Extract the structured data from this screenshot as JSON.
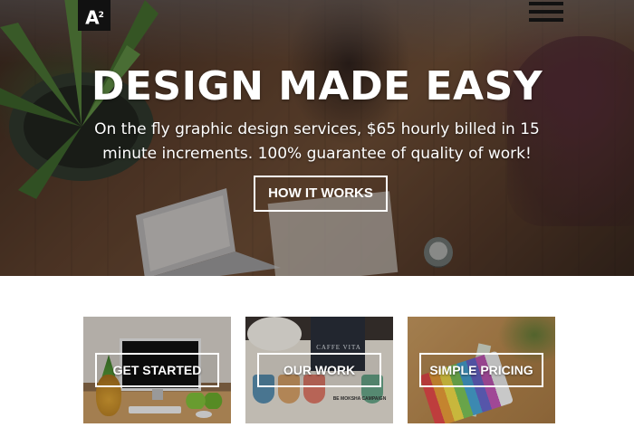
{
  "header": {
    "logo_text": "A",
    "logo_superscript": "2",
    "menu_icon": "hamburger-menu-icon"
  },
  "hero": {
    "title": "DESIGN MADE EASY",
    "subtitle": "On the fly graphic design services, $65 hourly billed in 15 minute increments. 100% guarantee of quality of work!",
    "button_label": "HOW IT WORKS"
  },
  "cards": [
    {
      "label": "GET STARTED"
    },
    {
      "label": "OUR WORK",
      "image_text": {
        "bag": "CAFFE VITA",
        "caption": "BE MOKSHA CAMPAIGN"
      }
    },
    {
      "label": "SIMPLE PRICING"
    }
  ]
}
